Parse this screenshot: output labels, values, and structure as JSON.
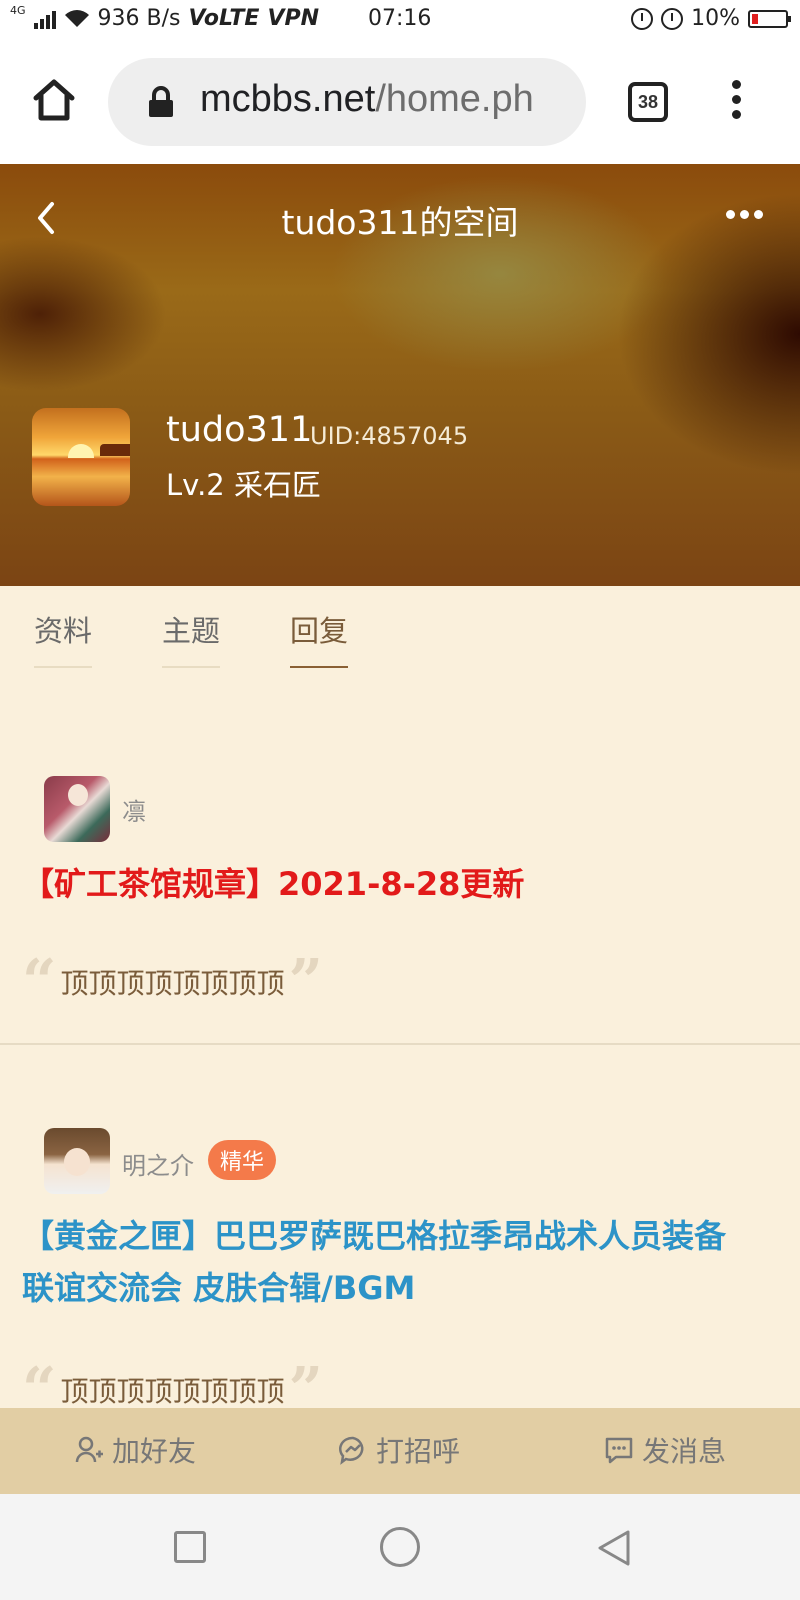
{
  "status_bar": {
    "network_type": "4G",
    "speed": "936 B/s",
    "volte": "VoLTE",
    "vpn": "VPN",
    "time": "07:16",
    "battery": "10%",
    "battery_color": "#e02020"
  },
  "browser": {
    "url_host": "mcbbs.net",
    "url_path": "/home.ph",
    "tab_count": "38"
  },
  "header": {
    "title": "tudo311的空间",
    "username": "tudo311",
    "uid": "UID:4857045",
    "level": "Lv.2 采石匠"
  },
  "tabs": [
    {
      "label": "资料",
      "active": false
    },
    {
      "label": "主题",
      "active": false
    },
    {
      "label": "回复",
      "active": true
    }
  ],
  "posts": [
    {
      "author": "凛",
      "title": "【矿工茶馆规章】2021-8-28更新",
      "title_color": "#e21a1a",
      "quote": "顶顶顶顶顶顶顶顶"
    },
    {
      "author": "明之介",
      "badge": "精华",
      "badge_color": "#f47a4a",
      "title_line1": "【黄金之匣】巴巴罗萨既巴格拉季昂战术人员装备",
      "title_line2": "联谊交流会 皮肤合辑/BGM",
      "title_color": "#2c93c8",
      "quote": "顶顶顶顶顶顶顶顶"
    }
  ],
  "actions": {
    "add_friend": "加好友",
    "greet": "打招呼",
    "message": "发消息"
  },
  "icons": {
    "home": "home-icon",
    "lock": "lock-icon",
    "menu": "more-vert-icon",
    "back": "chevron-left-icon",
    "more": "more-horiz-icon",
    "add_friend": "user-plus-icon",
    "greet": "messenger-icon",
    "message": "chat-icon"
  },
  "theme": {
    "accent": "#8a6034",
    "page_background": "#faf0dc",
    "action_bar": "#e2cea4"
  }
}
